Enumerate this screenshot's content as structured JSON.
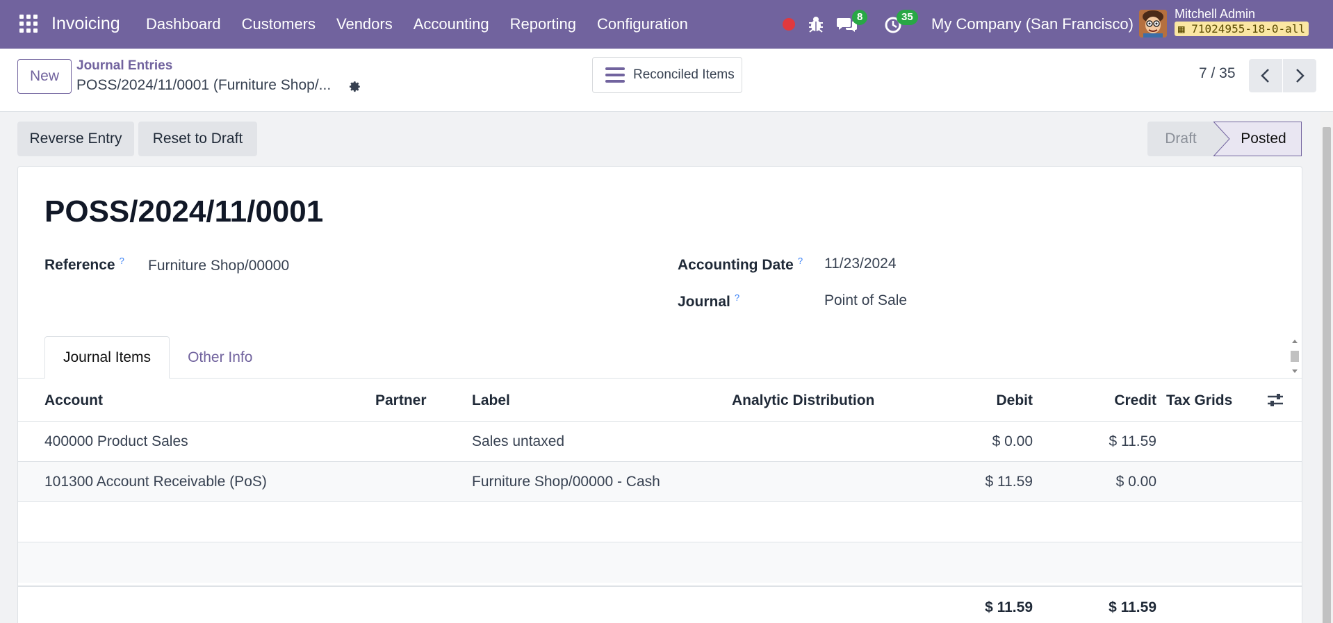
{
  "navbar": {
    "brand": "Invoicing",
    "menu": [
      "Dashboard",
      "Customers",
      "Vendors",
      "Accounting",
      "Reporting",
      "Configuration"
    ],
    "messages_count": "8",
    "activities_count": "35",
    "company": "My Company (San Francisco)",
    "user_name": "Mitchell Admin",
    "database": "71024955-18-0-all",
    "colors": {
      "bar": "#71639e",
      "badge": "#28a745",
      "record": "#e0393e"
    }
  },
  "control": {
    "new_label": "New",
    "breadcrumb_parent": "Journal Entries",
    "breadcrumb_current": "POSS/2024/11/0001 (Furniture Shop/...",
    "reconciled_label": "Reconciled Items",
    "pager": "7 / 35"
  },
  "actions": {
    "reverse_entry": "Reverse Entry",
    "reset_to_draft": "Reset to Draft"
  },
  "statusbar": {
    "draft": "Draft",
    "posted": "Posted",
    "current": "Posted"
  },
  "form": {
    "title": "POSS/2024/11/0001",
    "reference_label": "Reference",
    "reference_value": "Furniture Shop/00000",
    "date_label": "Accounting Date",
    "date_value": "11/23/2024",
    "journal_label": "Journal",
    "journal_value": "Point of Sale",
    "help_mark": "?"
  },
  "tabs": [
    "Journal Items",
    "Other Info"
  ],
  "table": {
    "headers": {
      "account": "Account",
      "partner": "Partner",
      "label": "Label",
      "analytic": "Analytic Distribution",
      "debit": "Debit",
      "credit": "Credit",
      "tax_grids": "Tax Grids"
    },
    "rows": [
      {
        "account": "400000 Product Sales",
        "partner": "",
        "label": "Sales untaxed",
        "debit": "$ 0.00",
        "credit": "$ 11.59"
      },
      {
        "account": "101300 Account Receivable (PoS)",
        "partner": "",
        "label": "Furniture Shop/00000 - Cash",
        "debit": "$ 11.59",
        "credit": "$ 0.00"
      }
    ],
    "total_debit": "$ 11.59",
    "total_credit": "$ 11.59"
  }
}
